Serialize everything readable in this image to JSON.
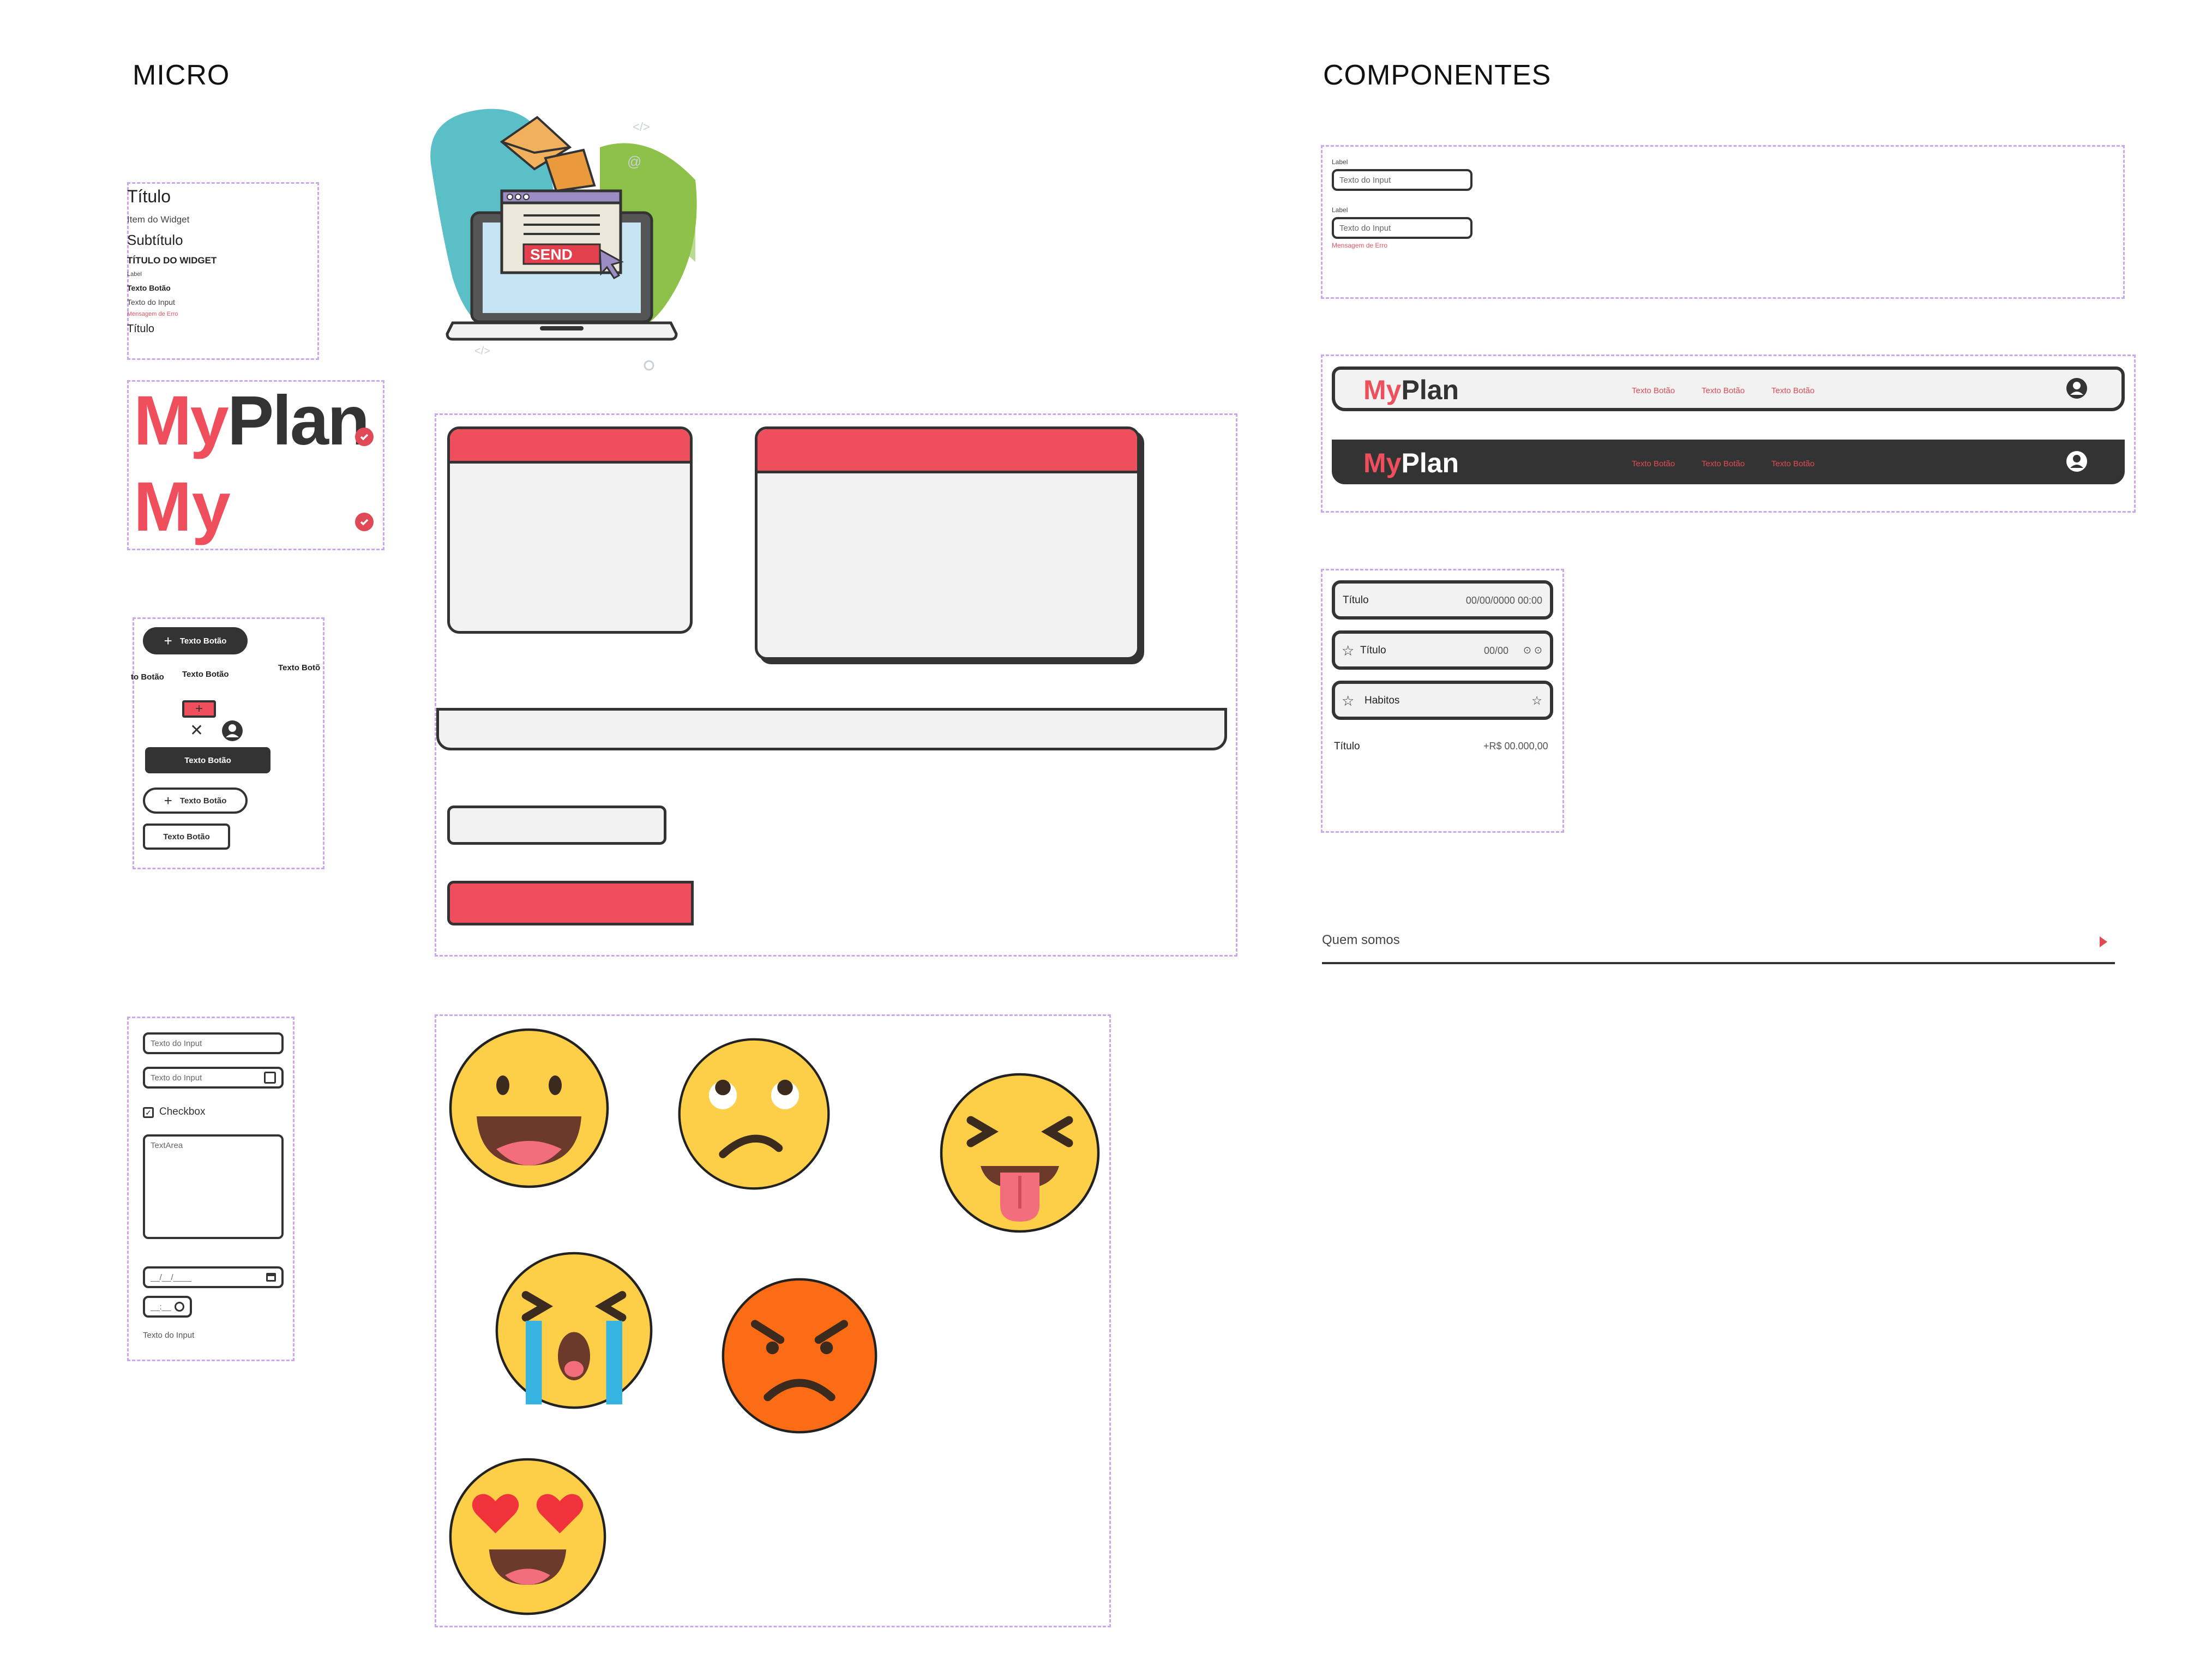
{
  "sections": {
    "micro": "MICRO",
    "componentes": "COMPONENTES"
  },
  "typography": {
    "titulo": "Título",
    "item_widget": "Item do Widget",
    "subtitulo": "Subtítulo",
    "titulo_widget": "TÍTULO DO WIDGET",
    "label": "Label",
    "texto_botao": "Texto Botão",
    "texto_input": "Texto do Input",
    "mensagem_erro": "Mensagem de Erro",
    "titulo2": "Título"
  },
  "logo": {
    "full": "MyPlan",
    "short": "My",
    "my": "My",
    "plan": "Plan"
  },
  "illustration": {
    "send": "SEND"
  },
  "buttons": {
    "pill_dark": "Texto Botão",
    "text_left": "to Botão",
    "text_mid": "Texto Botão",
    "text_right": "Texto Botõ",
    "dark_rect": "Texto Botão",
    "outline_pill": "Texto Botão",
    "outline_rect": "Texto Botão"
  },
  "inputs": {
    "input1": "Texto do Input",
    "input2": "Texto do Input",
    "checkbox": "Checkbox",
    "textarea": "TextArea",
    "date": "__/__/____",
    "time": "__:__",
    "helper": "Texto do Input"
  },
  "form_component": {
    "label1": "Label",
    "input1": "Texto do Input",
    "label2": "Label",
    "input2": "Texto do Input",
    "error": "Mensagem de Erro"
  },
  "navbars": [
    {
      "brand_my": "My",
      "brand_plan": "Plan",
      "links": [
        "Texto Botão",
        "Texto Botão",
        "Texto Botão"
      ],
      "theme": "light",
      "bg": "#f2f2f2"
    },
    {
      "brand_my": "My",
      "brand_plan": "Plan",
      "links": [
        "Texto Botão",
        "Texto Botão",
        "Texto Botão"
      ],
      "theme": "dark",
      "bg": "#333333"
    }
  ],
  "list_cards": {
    "card1": {
      "title": "Título",
      "date": "00/00/0000 00:00"
    },
    "card2": {
      "title": "Título",
      "date": "00/00"
    },
    "card3": {
      "title": "Habitos"
    },
    "row": {
      "title": "Título",
      "value": "+R$ 00.000,00"
    }
  },
  "accordion": {
    "label": "Quem somos"
  },
  "colors": {
    "brand_red": "#ef4f5c",
    "dark": "#333333",
    "light_bg": "#f2f2f2",
    "frame": "#c9a8ee"
  }
}
